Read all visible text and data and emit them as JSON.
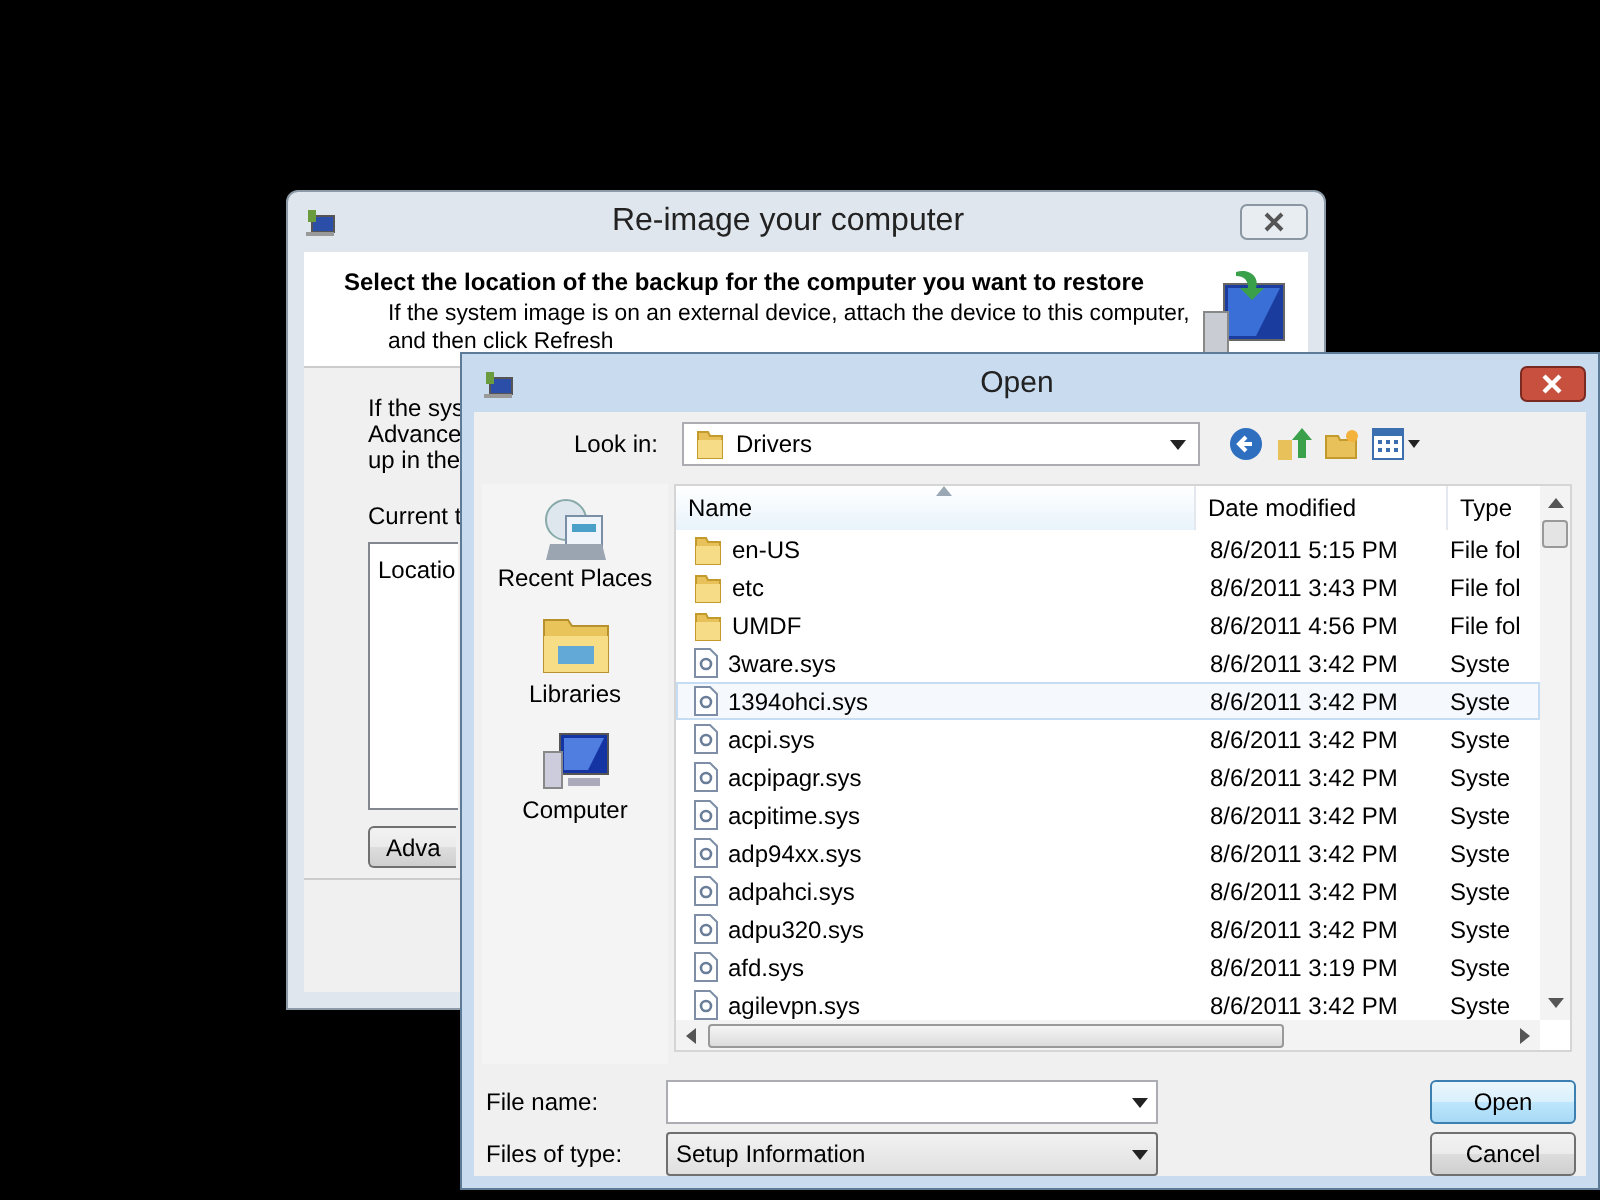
{
  "back_window": {
    "title": "Re-image your computer",
    "heading": "Select the location of the backup for the computer you want to restore",
    "description": "If the system image is on an external device, attach the device to this computer, and then click Refresh",
    "body_lines": [
      "If the sys",
      "Advance",
      "up in the"
    ],
    "current_label": "Current t",
    "table_column": "Locatio",
    "advanced_button": "Adva"
  },
  "open_dialog": {
    "title": "Open",
    "look_in_label": "Look in:",
    "look_in_value": "Drivers",
    "places": [
      {
        "label": "Recent Places",
        "kind": "recent"
      },
      {
        "label": "Libraries",
        "kind": "libraries"
      },
      {
        "label": "Computer",
        "kind": "computer"
      }
    ],
    "columns": [
      "Name",
      "Date modified",
      "Type"
    ],
    "rows": [
      {
        "name": "en-US",
        "date": "8/6/2011 5:15 PM",
        "type": "File fol",
        "kind": "folder",
        "selected": false
      },
      {
        "name": "etc",
        "date": "8/6/2011 3:43 PM",
        "type": "File fol",
        "kind": "folder",
        "selected": false
      },
      {
        "name": "UMDF",
        "date": "8/6/2011 4:56 PM",
        "type": "File fol",
        "kind": "folder",
        "selected": false
      },
      {
        "name": "3ware.sys",
        "date": "8/6/2011 3:42 PM",
        "type": "Syste",
        "kind": "file",
        "selected": false
      },
      {
        "name": "1394ohci.sys",
        "date": "8/6/2011 3:42 PM",
        "type": "Syste",
        "kind": "file",
        "selected": true
      },
      {
        "name": "acpi.sys",
        "date": "8/6/2011 3:42 PM",
        "type": "Syste",
        "kind": "file",
        "selected": false
      },
      {
        "name": "acpipagr.sys",
        "date": "8/6/2011 3:42 PM",
        "type": "Syste",
        "kind": "file",
        "selected": false
      },
      {
        "name": "acpitime.sys",
        "date": "8/6/2011 3:42 PM",
        "type": "Syste",
        "kind": "file",
        "selected": false
      },
      {
        "name": "adp94xx.sys",
        "date": "8/6/2011 3:42 PM",
        "type": "Syste",
        "kind": "file",
        "selected": false
      },
      {
        "name": "adpahci.sys",
        "date": "8/6/2011 3:42 PM",
        "type": "Syste",
        "kind": "file",
        "selected": false
      },
      {
        "name": "adpu320.sys",
        "date": "8/6/2011 3:42 PM",
        "type": "Syste",
        "kind": "file",
        "selected": false
      },
      {
        "name": "afd.sys",
        "date": "8/6/2011 3:19 PM",
        "type": "Syste",
        "kind": "file",
        "selected": false
      },
      {
        "name": "agilevpn.sys",
        "date": "8/6/2011 3:42 PM",
        "type": "Syste",
        "kind": "file",
        "selected": false
      }
    ],
    "file_name_label": "File name:",
    "files_of_type_label": "Files of type:",
    "files_of_type_value": "Setup Information",
    "buttons": [
      "Open",
      "Cancel"
    ]
  }
}
